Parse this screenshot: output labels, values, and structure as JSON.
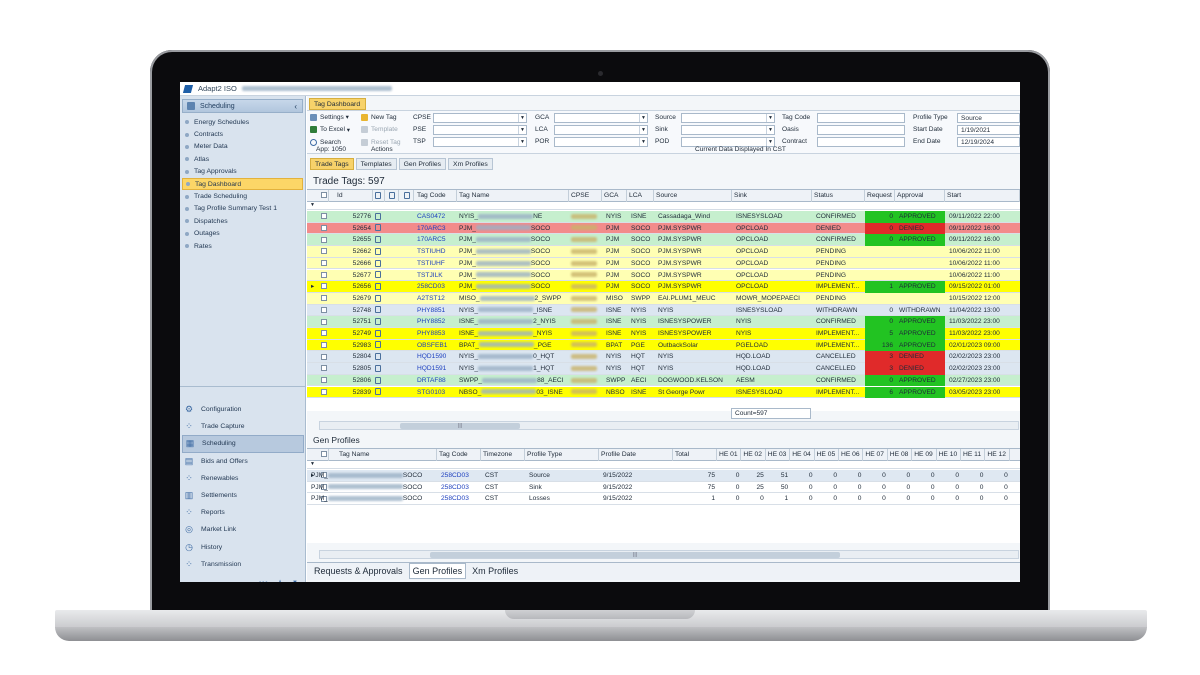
{
  "app": {
    "title": "Adapt2 ISO"
  },
  "sidebar": {
    "section": "Scheduling",
    "items": [
      {
        "label": "Energy Schedules",
        "active": false
      },
      {
        "label": "Contracts",
        "active": false
      },
      {
        "label": "Meter Data",
        "active": false
      },
      {
        "label": "Atlas",
        "active": false
      },
      {
        "label": "Tag Approvals",
        "active": false
      },
      {
        "label": "Tag Dashboard",
        "active": true
      },
      {
        "label": "Trade Scheduling",
        "active": false
      },
      {
        "label": "Tag Profile Summary Test 1",
        "active": false
      },
      {
        "label": "Dispatches",
        "active": false
      },
      {
        "label": "Outages",
        "active": false
      },
      {
        "label": "Rates",
        "active": false
      }
    ],
    "nav": [
      {
        "label": "Configuration",
        "icon": "gear-icon",
        "active": false
      },
      {
        "label": "Trade Capture",
        "icon": "dots-icon",
        "active": false
      },
      {
        "label": "Scheduling",
        "icon": "calendar-icon",
        "active": true
      },
      {
        "label": "Bids and Offers",
        "icon": "clipboard-icon",
        "active": false
      },
      {
        "label": "Renewables",
        "icon": "dots-icon",
        "active": false
      },
      {
        "label": "Settlements",
        "icon": "doc-icon",
        "active": false
      },
      {
        "label": "Reports",
        "icon": "dots-icon",
        "active": false
      },
      {
        "label": "Market Link",
        "icon": "compass-icon",
        "active": false
      },
      {
        "label": "History",
        "icon": "clock-icon",
        "active": false
      },
      {
        "label": "Transmission",
        "icon": "dots-icon",
        "active": false
      }
    ]
  },
  "doc_tab": "Tag Dashboard",
  "toolbar": {
    "settings": "Settings",
    "to_excel": "To Excel",
    "search": "Search",
    "app_version": "App: 1050",
    "new_tag": "New Tag",
    "template": "Template",
    "reset_tag": "Reset Tag",
    "actions": "Actions",
    "labels": {
      "cpse": "CPSE",
      "pse": "PSE",
      "tsp": "TSP",
      "gca": "GCA",
      "lca": "LCA",
      "por": "POR",
      "source": "Source",
      "sink": "Sink",
      "pod": "POD",
      "tag_code": "Tag Code",
      "oasis": "Oasis",
      "contract": "Contract",
      "profile_type": "Profile Type",
      "start_date": "Start Date",
      "end_date": "End Date"
    },
    "values": {
      "profile_type": "Source",
      "start_date": "1/19/2021",
      "end_date": "12/19/2024"
    },
    "current_data": "Current Data Displayed In CST"
  },
  "subtabs": [
    {
      "label": "Trade Tags",
      "active": true
    },
    {
      "label": "Templates",
      "active": false
    },
    {
      "label": "Gen Profiles",
      "active": false
    },
    {
      "label": "Xm Profiles",
      "active": false
    }
  ],
  "trade_tags": {
    "title": "Trade Tags: 597",
    "headers": [
      "Id",
      "Tag Code",
      "Tag Name",
      "CPSE",
      "GCA",
      "LCA",
      "Source",
      "Sink",
      "Status",
      "Request",
      "Approval",
      "Start"
    ],
    "rows": [
      {
        "id": "52776",
        "code": "CAS0472",
        "name": "NYIS_",
        "name_end": "NE",
        "gca": "NYIS",
        "lca": "ISNE",
        "source": "Cassadaga_Wind",
        "sink": "ISNESYSLOAD",
        "status": "CONFIRMED",
        "request": "0",
        "approval": "APPROVED",
        "start": "09/11/2022 22:00",
        "bg": "#c6efce",
        "approval_bg": "#22c322"
      },
      {
        "id": "52654",
        "code": "170ARC3",
        "name": "PJM_",
        "name_end": "SOCO",
        "gca": "PJM",
        "lca": "SOCO",
        "source": "PJM.SYSPWR",
        "sink": "OPCLOAD",
        "status": "DENIED",
        "request": "0",
        "approval": "DENIED",
        "start": "09/11/2022 16:00",
        "bg": "#f28b8b",
        "approval_bg": "#e02a2a"
      },
      {
        "id": "52655",
        "code": "170ARC5",
        "name": "PJM_",
        "name_end": "SOCO",
        "gca": "PJM",
        "lca": "SOCO",
        "source": "PJM.SYSPWR",
        "sink": "OPCLOAD",
        "status": "CONFIRMED",
        "request": "0",
        "approval": "APPROVED",
        "start": "09/11/2022 16:00",
        "bg": "#c6efce",
        "approval_bg": "#22c322"
      },
      {
        "id": "52662",
        "code": "TSTIUHD",
        "name": "PJM_",
        "name_end": "SOCO",
        "gca": "PJM",
        "lca": "SOCO",
        "source": "PJM.SYSPWR",
        "sink": "OPCLOAD",
        "status": "PENDING",
        "request": "",
        "approval": "",
        "start": "10/06/2022 11:00",
        "bg": "#ffffb3",
        "approval_bg": ""
      },
      {
        "id": "52666",
        "code": "TSTIUHF",
        "name": "PJM_",
        "name_end": "SOCO",
        "gca": "PJM",
        "lca": "SOCO",
        "source": "PJM.SYSPWR",
        "sink": "OPCLOAD",
        "status": "PENDING",
        "request": "",
        "approval": "",
        "start": "10/06/2022 11:00",
        "bg": "#ffffb3",
        "approval_bg": ""
      },
      {
        "id": "52677",
        "code": "TSTJILK",
        "name": "PJM_",
        "name_end": "SOCO",
        "gca": "PJM",
        "lca": "SOCO",
        "source": "PJM.SYSPWR",
        "sink": "OPCLOAD",
        "status": "PENDING",
        "request": "",
        "approval": "",
        "start": "10/06/2022 11:00",
        "bg": "#ffffb3",
        "approval_bg": ""
      },
      {
        "id": "52656",
        "code": "258CD03",
        "name": "PJM_",
        "name_end": "SOCO",
        "gca": "PJM",
        "lca": "SOCO",
        "source": "PJM.SYSPWR",
        "sink": "OPCLOAD",
        "status": "IMPLEMENT...",
        "request": "1",
        "approval": "APPROVED",
        "start": "09/15/2022 01:00",
        "bg": "#ffff00",
        "approval_bg": "#22c322"
      },
      {
        "id": "52679",
        "code": "A2TST12",
        "name": "MISO_",
        "name_end": "2_SWPP",
        "gca": "MISO",
        "lca": "SWPP",
        "source": "EAI.PLUM1_MEUC",
        "sink": "MOWR_MOPEPAECI",
        "status": "PENDING",
        "request": "",
        "approval": "",
        "start": "10/15/2022 12:00",
        "bg": "#ffffb3",
        "approval_bg": ""
      },
      {
        "id": "52748",
        "code": "PHY8851",
        "name": "NYIS_",
        "name_end": "_ISNE",
        "gca": "ISNE",
        "lca": "NYIS",
        "source": "NYIS",
        "sink": "ISNESYSLOAD",
        "status": "WITHDRAWN",
        "request": "0",
        "approval": "WITHDRAWN",
        "start": "11/04/2022 13:00",
        "bg": "#dce6f1",
        "approval_bg": ""
      },
      {
        "id": "52751",
        "code": "PHY8852",
        "name": "ISNE_",
        "name_end": "2_NYIS",
        "gca": "ISNE",
        "lca": "NYIS",
        "source": "ISNESYSPOWER",
        "sink": "NYIS",
        "status": "CONFIRMED",
        "request": "0",
        "approval": "APPROVED",
        "start": "11/03/2022 23:00",
        "bg": "#c6efce",
        "approval_bg": "#22c322"
      },
      {
        "id": "52749",
        "code": "PHY8853",
        "name": "ISNE_",
        "name_end": "_NYIS",
        "gca": "ISNE",
        "lca": "NYIS",
        "source": "ISNESYSPOWER",
        "sink": "NYIS",
        "status": "IMPLEMENT...",
        "request": "5",
        "approval": "APPROVED",
        "start": "11/03/2022 23:00",
        "bg": "#ffff00",
        "approval_bg": "#22c322"
      },
      {
        "id": "52983",
        "code": "OBSFEB1",
        "name": "BPAT_",
        "name_end": "_PGE",
        "gca": "BPAT",
        "lca": "PGE",
        "source": "OutbackSolar",
        "sink": "PGELOAD",
        "status": "IMPLEMENT...",
        "request": "136",
        "approval": "APPROVED",
        "start": "02/01/2023 09:00",
        "bg": "#ffff00",
        "approval_bg": "#22c322"
      },
      {
        "id": "52804",
        "code": "HQD1590",
        "name": "NYIS_",
        "name_end": "0_HQT",
        "gca": "NYIS",
        "lca": "HQT",
        "source": "NYIS",
        "sink": "HQD.LOAD",
        "status": "CANCELLED",
        "request": "3",
        "approval": "DENIED",
        "start": "02/02/2023 23:00",
        "bg": "#dce6f1",
        "approval_bg": "#e02a2a"
      },
      {
        "id": "52805",
        "code": "HQD1591",
        "name": "NYIS_",
        "name_end": "1_HQT",
        "gca": "NYIS",
        "lca": "HQT",
        "source": "NYIS",
        "sink": "HQD.LOAD",
        "status": "CANCELLED",
        "request": "3",
        "approval": "DENIED",
        "start": "02/02/2023 23:00",
        "bg": "#dce6f1",
        "approval_bg": "#e02a2a"
      },
      {
        "id": "52806",
        "code": "DRTAF88",
        "name": "SWPP_",
        "name_end": "88_AECI",
        "gca": "SWPP",
        "lca": "AECI",
        "source": "DOGWOOD.KELSON",
        "sink": "AESM",
        "status": "CONFIRMED",
        "request": "0",
        "approval": "APPROVED",
        "start": "02/27/2023 23:00",
        "bg": "#c6efce",
        "approval_bg": "#22c322"
      },
      {
        "id": "52839",
        "code": "STG0103",
        "name": "NBSO_",
        "name_end": "03_ISNE",
        "gca": "NBSO",
        "lca": "ISNE",
        "source": "St George Powr",
        "sink": "ISNESYSLOAD",
        "status": "IMPLEMENT...",
        "request": "6",
        "approval": "APPROVED",
        "start": "03/05/2023 23:00",
        "bg": "#ffff00",
        "approval_bg": "#22c322"
      }
    ],
    "count": "Count=597"
  },
  "gen_profiles": {
    "title": "Gen Profiles",
    "headers": [
      "Tag Name",
      "Tag Code",
      "Timezone",
      "Profile Type",
      "Profile Date",
      "Total",
      "HE 01",
      "HE 02",
      "HE 03",
      "HE 04",
      "HE 05",
      "HE 06",
      "HE 07",
      "HE 08",
      "HE 09",
      "HE 10",
      "HE 11",
      "HE 12"
    ],
    "rows": [
      {
        "name": "PJM_",
        "name_end": "SOCO",
        "code": "258CD03",
        "tz": "CST",
        "type": "Source",
        "date": "9/15/2022",
        "total": "75",
        "he": [
          "0",
          "25",
          "51",
          "0",
          "0",
          "0",
          "0",
          "0",
          "0",
          "0",
          "0",
          "0"
        ]
      },
      {
        "name": "PJM_",
        "name_end": "SOCO",
        "code": "258CD03",
        "tz": "CST",
        "type": "Sink",
        "date": "9/15/2022",
        "total": "75",
        "he": [
          "0",
          "25",
          "50",
          "0",
          "0",
          "0",
          "0",
          "0",
          "0",
          "0",
          "0",
          "0"
        ]
      },
      {
        "name": "PJM_",
        "name_end": "SOCO",
        "code": "258CD03",
        "tz": "CST",
        "type": "Losses",
        "date": "9/15/2022",
        "total": "1",
        "he": [
          "0",
          "0",
          "1",
          "0",
          "0",
          "0",
          "0",
          "0",
          "0",
          "0",
          "0",
          "0"
        ]
      }
    ]
  },
  "bottom_tabs": [
    {
      "label": "Requests & Approvals",
      "active": false
    },
    {
      "label": "Gen Profiles",
      "active": true
    },
    {
      "label": "Xm Profiles",
      "active": false
    }
  ]
}
